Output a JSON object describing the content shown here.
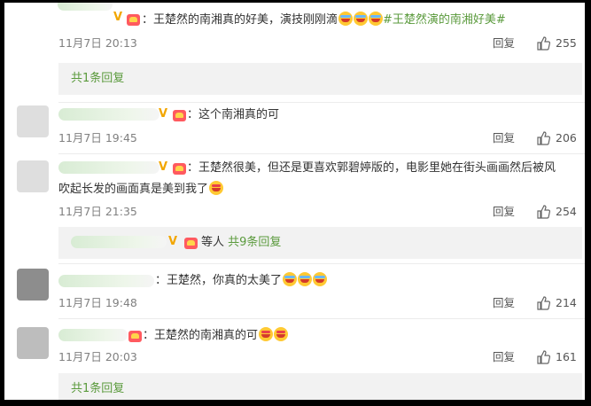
{
  "comments": [
    {
      "text": "：王楚然的南湘真的好美，演技刚刚滴",
      "hashtag": "#王楚然演的南湘好美#",
      "time": "11月7日 20:13",
      "reply": "回复",
      "likes": "255",
      "emojis": [
        "emoji-cry-face",
        "emoji-cry-face",
        "emoji-cry-face"
      ]
    },
    {
      "text": "：这个南湘真的可",
      "time": "11月7日 19:45",
      "reply": "回复",
      "likes": "206"
    },
    {
      "text_line1": "：王楚然很美，但还是更喜欢郭碧婷版的，电影里她在街头画画然后被风",
      "text_line2": "吹起长发的画面真是美到我了",
      "time": "11月7日 21:35",
      "reply": "回复",
      "likes": "254",
      "emojis": [
        "emoji-heart-eyes-face"
      ]
    },
    {
      "text": "：王楚然，你真的太美了",
      "time": "11月7日 19:48",
      "reply": "回复",
      "likes": "214",
      "emojis": [
        "emoji-cry-face",
        "emoji-cry-face",
        "emoji-cry-face"
      ]
    },
    {
      "text": "：王楚然的南湘真的可",
      "time": "11月7日 20:03",
      "reply": "回复",
      "likes": "161",
      "emojis": [
        "emoji-heart-eyes-face",
        "emoji-heart-eyes-face"
      ]
    }
  ],
  "sub": {
    "s1": "共1条回复",
    "s2_prefix": "等人",
    "s2_count": "共9条回复",
    "s3": "共1条回复"
  },
  "colors": {
    "accent_green": "#5a9a3c",
    "vip_gold": "#f2a600",
    "text": "#333333",
    "muted": "#808080"
  }
}
